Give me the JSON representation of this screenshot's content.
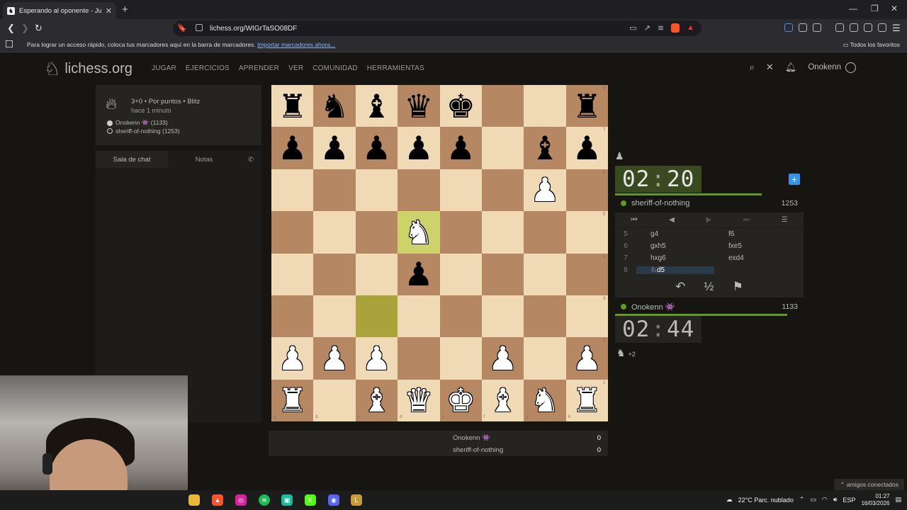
{
  "browser": {
    "tab_title": "Esperando al oponente - Jugar",
    "tab_close": "✕",
    "new_tab": "+",
    "url": "lichess.org/WIGrTaSO08DF",
    "bookmarks_message": "Para lograr un acceso rápido, coloca tus marcadores aquí en la barra de marcadores.",
    "bookmarks_import": "Importar marcadores ahora...",
    "all_favorites": "Todos los favoritos"
  },
  "header": {
    "logo": "lichess.org",
    "nav": [
      "JUGAR",
      "EJERCICIOS",
      "APRENDER",
      "VER",
      "COMUNIDAD",
      "HERRAMIENTAS"
    ],
    "username": "Onokenn"
  },
  "game": {
    "setup": "3+0 • Por puntos • Blitz",
    "ago": "hace 1 minuto",
    "white_player": "Onokenn 👾 (1133)",
    "black_player": "sheriff-of-nothing (1253)"
  },
  "chat": {
    "tab_chat": "Sala de chat",
    "tab_notes": "Notas"
  },
  "board": {
    "ranks": [
      [
        "br",
        "bn",
        "bb",
        "bq",
        "bk",
        "",
        "",
        "br"
      ],
      [
        "bp",
        "bp",
        "bp",
        "bp",
        "bp",
        "",
        "bb",
        "bp"
      ],
      [
        "",
        "",
        "",
        "",
        "",
        "",
        "wp",
        ""
      ],
      [
        "",
        "",
        "",
        "wn",
        "",
        "",
        "",
        ""
      ],
      [
        "",
        "",
        "",
        "bp",
        "",
        "",
        "",
        ""
      ],
      [
        "",
        "",
        "",
        "",
        "",
        "",
        "",
        ""
      ],
      [
        "wp",
        "wp",
        "wp",
        "",
        "",
        "wp",
        "",
        "wp"
      ],
      [
        "wr",
        "",
        "wb",
        "wq",
        "wk",
        "wb",
        "wn",
        "wr"
      ]
    ],
    "highlight": [
      "d5",
      "c3"
    ],
    "files": [
      "a",
      "b",
      "c",
      "d",
      "e",
      "f",
      "g",
      "h"
    ],
    "rank_labels": [
      "8",
      "7",
      "6",
      "5",
      "4",
      "3",
      "2",
      "1"
    ]
  },
  "opponent": {
    "name": "sheriff-of-nothing",
    "rating": "1253",
    "clock": {
      "min": "02",
      "sec": "20"
    }
  },
  "me": {
    "name": "Onokenn 👾",
    "rating": "1133",
    "clock": {
      "min": "02",
      "sec": "44"
    },
    "material": "+2"
  },
  "moves": [
    {
      "n": "5",
      "w": "g4",
      "b": "f6"
    },
    {
      "n": "6",
      "w": "gxh5",
      "b": "fxe5"
    },
    {
      "n": "7",
      "w": "hxg6",
      "b": "exd4"
    },
    {
      "n": "8",
      "w": "♘d5",
      "b": ""
    }
  ],
  "actions": {
    "takeback": "↶",
    "draw": "½",
    "resign": "⚑"
  },
  "crosstable": [
    {
      "name": "Onokenn 👾",
      "score": "0"
    },
    {
      "name": "sheriff-of-nothing",
      "score": "0"
    }
  ],
  "footer": {
    "friends": "amigos conectados"
  },
  "taskbar": {
    "weather": "22°C  Parc. nublado",
    "lang": "ESP",
    "time": "01:27",
    "date": "16/03/2026"
  },
  "colors": {
    "light_square": "#f0d9b5",
    "dark_square": "#b58863",
    "highlight": "#cdd26a",
    "accent_green": "#629924",
    "accent_blue": "#3692e7"
  }
}
